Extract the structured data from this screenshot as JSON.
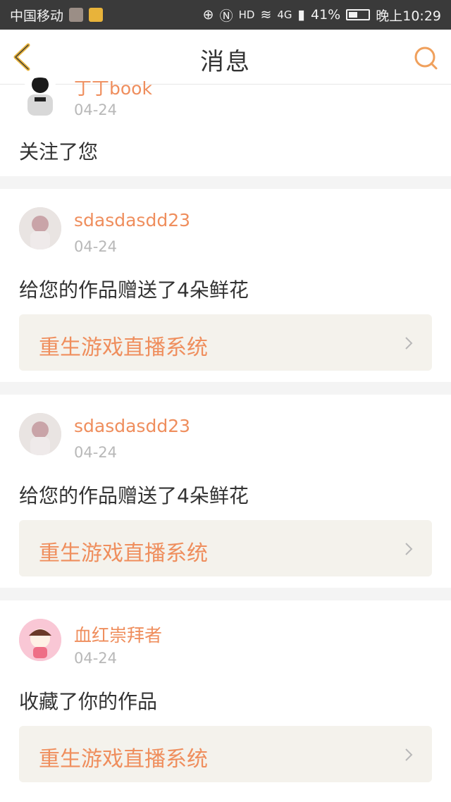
{
  "status_bar": {
    "carrier": "中国移动",
    "network_badge": "4G",
    "battery": "41%",
    "time": "晚上10:29",
    "icons": [
      "shield-icon",
      "app-icon",
      "signal-icon",
      "nfc-icon",
      "hd-icon",
      "wifi-icon",
      "cell-signal-icon",
      "battery-icon"
    ]
  },
  "header": {
    "title": "消息",
    "back_icon": "chevron-left-icon",
    "search_icon": "search-icon",
    "accent": "#f0a05c"
  },
  "messages": [
    {
      "user": "丁丁book",
      "date": "04-24",
      "text": "关注了您"
    },
    {
      "user": "sdasdasdd23",
      "date": "04-24",
      "text": "给您的作品赠送了4朵鲜花",
      "work": "重生游戏直播系统"
    },
    {
      "user": "sdasdasdd23",
      "date": "04-24",
      "text": "给您的作品赠送了4朵鲜花",
      "work": "重生游戏直播系统"
    },
    {
      "user": "血红崇拜者",
      "date": "04-24",
      "text": "收藏了你的作品",
      "work": "重生游戏直播系统"
    }
  ],
  "colors": {
    "username": "#ef8e5d",
    "date": "#b8b8b8",
    "work_bg": "#f4f2ec"
  }
}
